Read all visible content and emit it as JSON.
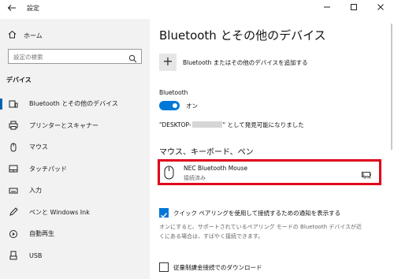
{
  "window": {
    "title": "設定",
    "back_icon": "back-arrow-icon",
    "controls": [
      "minimize-icon",
      "maximize-icon",
      "close-icon"
    ]
  },
  "sidebar": {
    "home_label": "ホーム",
    "search_placeholder": "設定の検索",
    "section": "デバイス",
    "items": [
      {
        "label": "Bluetooth とその他のデバイス",
        "icon": "bluetooth-devices-icon",
        "active": true
      },
      {
        "label": "プリンターとスキャナー",
        "icon": "printer-icon",
        "active": false
      },
      {
        "label": "マウス",
        "icon": "mouse-icon",
        "active": false
      },
      {
        "label": "タッチパッド",
        "icon": "touchpad-icon",
        "active": false
      },
      {
        "label": "入力",
        "icon": "keyboard-icon",
        "active": false
      },
      {
        "label": "ペンと Windows Ink",
        "icon": "pen-icon",
        "active": false
      },
      {
        "label": "自動再生",
        "icon": "autoplay-icon",
        "active": false
      },
      {
        "label": "USB",
        "icon": "usb-icon",
        "active": false
      }
    ]
  },
  "main": {
    "title": "Bluetooth とその他のデバイス",
    "add_device_label": "Bluetooth またはその他のデバイスを追加する",
    "bluetooth_label": "Bluetooth",
    "toggle_state": "オン",
    "discover_prefix": "\"DESKTOP-",
    "discover_suffix": "\" として発見可能になりました",
    "section_title": "マウス、キーボード、ペン",
    "device": {
      "name": "NEC Bluetooth Mouse",
      "status": "接続済み",
      "battery": "9%"
    },
    "swift_pair_label": "クイック ペアリングを使用して接続するための通知を表示する",
    "swift_pair_checked": true,
    "swift_pair_note": "オンにすると、サポートされているペアリング モードの Bluetooth デバイスが近くにある場合は、すばやく接続できます。",
    "metered_label": "従量制課金接続でのダウンロード",
    "metered_checked": false
  },
  "colors": {
    "accent": "#0078d7",
    "highlight": "#e0001b",
    "sidebar_bg": "#f2f2f2"
  }
}
